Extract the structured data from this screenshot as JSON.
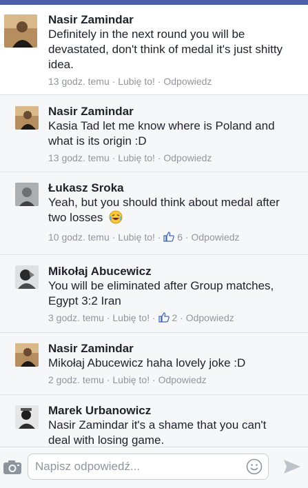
{
  "comments": [
    {
      "name": "Nasir Zamindar",
      "lines": [
        "Definitely in the next round you will be",
        "devastated, don't think of medal it's just shitty",
        "idea."
      ],
      "time": "13 godz. temu",
      "like": "Lubię to!",
      "likes": "",
      "reply": "Odpowiedz"
    },
    {
      "name": "Nasir Zamindar",
      "lines": [
        "Kasia Tad let me know where is Poland and",
        "what is its origin :D"
      ],
      "time": "13 godz. temu",
      "like": "Lubię to!",
      "likes": "",
      "reply": "Odpowiedz"
    },
    {
      "name": "Łukasz Sroka",
      "lines": [
        "Yeah, but you should think about medal after",
        "two losses"
      ],
      "time": "10 godz. temu",
      "like": "Lubię to!",
      "likes": "6",
      "reply": "Odpowiedz"
    },
    {
      "name": "Mikołaj Abucewicz",
      "lines": [
        "You will be eliminated after Group matches,",
        "Egypt 3:2 Iran"
      ],
      "time": "3 godz. temu",
      "like": "Lubię to!",
      "likes": "2",
      "reply": "Odpowiedz"
    },
    {
      "name": "Nasir Zamindar",
      "lines": [
        "Mikołaj Abucewicz haha lovely joke :D"
      ],
      "time": "2 godz. temu",
      "like": "Lubię to!",
      "likes": "",
      "reply": "Odpowiedz"
    },
    {
      "name": "Marek Urbanowicz",
      "lines": [
        "Nasir Zamindar it's a shame that you can't",
        "deal with losing game."
      ],
      "time": "",
      "like": "",
      "likes": "",
      "reply": ""
    }
  ],
  "composer": {
    "placeholder": "Napisz odpowiedź..."
  },
  "icons": {
    "camera": "camera-icon",
    "emoji": "emoji-icon",
    "send": "send-icon",
    "like": "thumbs-up-icon",
    "laugh": "laughing-tears-emoji"
  },
  "colors": {
    "accent": "#4b60a6",
    "meta": "#90949c",
    "like_blue": "#4267b2"
  }
}
